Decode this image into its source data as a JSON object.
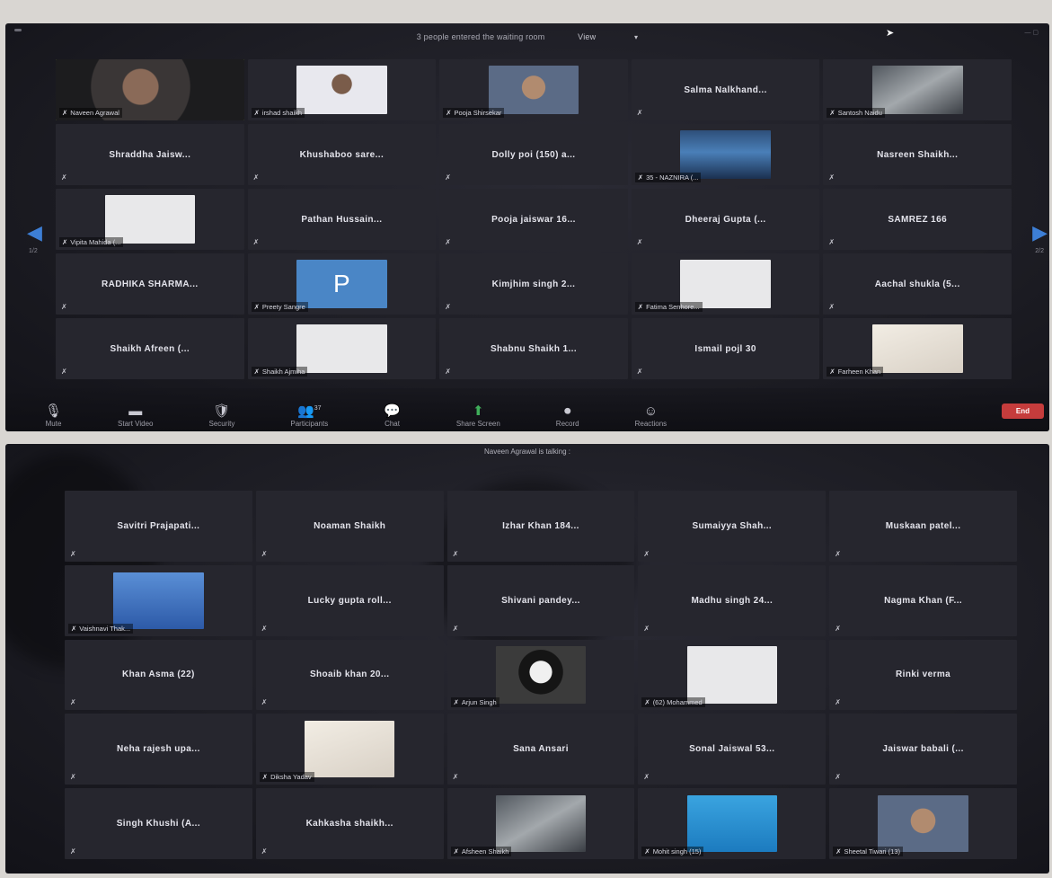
{
  "top": {
    "notice": "3 people entered the waiting room",
    "view_label": "View",
    "caret": "▾",
    "nav_left": "◀",
    "nav_right": "▶",
    "page_left": "1/2",
    "page_right": "2/2",
    "tiles": [
      {
        "name": "Naveen Agrawal",
        "kind": "caption",
        "thumb": "video"
      },
      {
        "name": "irshad shaikh",
        "kind": "caption",
        "thumb": "person"
      },
      {
        "name": "Pooja Shirsekar",
        "kind": "caption",
        "thumb": "face"
      },
      {
        "name": "Salma Nalkhand...",
        "kind": "name"
      },
      {
        "name": "Santosh Naidu",
        "kind": "caption",
        "thumb": "photo"
      },
      {
        "name": "Shraddha Jaisw...",
        "kind": "name"
      },
      {
        "name": "Khushaboo sare...",
        "kind": "name"
      },
      {
        "name": "Dolly poi (150) a...",
        "kind": "name"
      },
      {
        "name": "35 - NAZNIRA (...",
        "kind": "caption",
        "thumb": "lake"
      },
      {
        "name": "Nasreen Shaikh...",
        "kind": "name"
      },
      {
        "name": "Vipita Mahida (...",
        "kind": "caption",
        "thumb": "white"
      },
      {
        "name": "Pathan Hussain...",
        "kind": "name"
      },
      {
        "name": "Pooja jaiswar 16...",
        "kind": "name"
      },
      {
        "name": "Dheeraj Gupta (...",
        "kind": "name"
      },
      {
        "name": "SAMREZ 166",
        "kind": "name"
      },
      {
        "name": "RADHIKA SHARMA...",
        "kind": "name"
      },
      {
        "name": "Preety Sangre",
        "kind": "caption",
        "thumb": "plain-p",
        "letter": "P"
      },
      {
        "name": "Kimjhim singh 2...",
        "kind": "name"
      },
      {
        "name": "Fatima Senhore...",
        "kind": "caption",
        "thumb": "white"
      },
      {
        "name": "Aachal shukla (5...",
        "kind": "name"
      },
      {
        "name": "Shaikh Afreen (...",
        "kind": "name"
      },
      {
        "name": "Shaikh Ajmiha",
        "kind": "caption",
        "thumb": "white"
      },
      {
        "name": "Shabnu Shaikh 1...",
        "kind": "name"
      },
      {
        "name": "Ismail pojl 30",
        "kind": "name"
      },
      {
        "name": "Farheen Khan",
        "kind": "caption",
        "thumb": "pale"
      }
    ],
    "toolbar": [
      {
        "icon": "🎙",
        "label": "Mute"
      },
      {
        "icon": "▬",
        "label": "Start Video"
      },
      {
        "icon": "🛡",
        "label": "Security"
      },
      {
        "icon": "👥",
        "label": "Participants"
      },
      {
        "icon": "💬",
        "label": "Chat"
      },
      {
        "icon": "⬆",
        "label": "Share Screen"
      },
      {
        "icon": "⏺",
        "label": "Record"
      },
      {
        "icon": "☺",
        "label": "Reactions"
      }
    ],
    "participants_count": "37",
    "end_label": "End"
  },
  "bottom": {
    "speaking": "Naveen Agrawal is talking :",
    "tiles": [
      {
        "name": "Savitri Prajapati...",
        "kind": "name"
      },
      {
        "name": "Noaman Shaikh",
        "kind": "name"
      },
      {
        "name": "Izhar Khan 184...",
        "kind": "name"
      },
      {
        "name": "Sumaiyya Shah...",
        "kind": "name"
      },
      {
        "name": "Muskaan patel...",
        "kind": "name"
      },
      {
        "name": "Vaishnavi Thak...",
        "kind": "caption",
        "thumb": "sky"
      },
      {
        "name": "Lucky gupta roll...",
        "kind": "name"
      },
      {
        "name": "Shivani pandey...",
        "kind": "name"
      },
      {
        "name": "Madhu singh 24...",
        "kind": "name"
      },
      {
        "name": "Nagma Khan (F...",
        "kind": "name"
      },
      {
        "name": "Khan Asma (22)",
        "kind": "name"
      },
      {
        "name": "Shoaib khan 20...",
        "kind": "name"
      },
      {
        "name": "Arjun Singh",
        "kind": "caption",
        "thumb": "panda"
      },
      {
        "name": "(62) Mohammed",
        "kind": "caption",
        "thumb": "white"
      },
      {
        "name": "Rinki verma",
        "kind": "name"
      },
      {
        "name": "Neha rajesh upa...",
        "kind": "name"
      },
      {
        "name": "Diksha Yadav",
        "kind": "caption",
        "thumb": "pale"
      },
      {
        "name": "Sana Ansari",
        "kind": "name"
      },
      {
        "name": "Sonal Jaiswal 53...",
        "kind": "name"
      },
      {
        "name": "Jaiswar babali (...",
        "kind": "name"
      },
      {
        "name": "Singh Khushi (A...",
        "kind": "name"
      },
      {
        "name": "Kahkasha shaikh...",
        "kind": "name"
      },
      {
        "name": "Afsheen Shaikh",
        "kind": "caption",
        "thumb": "photo"
      },
      {
        "name": "Mohit singh (15)",
        "kind": "caption",
        "thumb": "blue"
      },
      {
        "name": "Sheetal Tiwari (13)",
        "kind": "caption",
        "thumb": "face"
      }
    ]
  },
  "icons": {
    "mic_muted": "✗",
    "cursor": "➤"
  }
}
